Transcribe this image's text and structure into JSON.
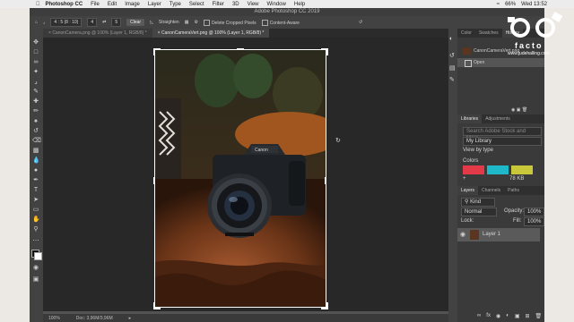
{
  "menubar": {
    "app_name": "Photoshop CC",
    "items": [
      "File",
      "Edit",
      "Image",
      "Layer",
      "Type",
      "Select",
      "Filter",
      "3D",
      "View",
      "Window",
      "Help"
    ],
    "battery": "66%",
    "clock": "Wed 13:52"
  },
  "window": {
    "title": "Adobe Photoshop CC 2019"
  },
  "options": {
    "ratio": "4 : 5 (8 : 10)",
    "width": "4",
    "height": "5",
    "clear_label": "Clear",
    "straighten_label": "Straighten",
    "delete_cropped_label": "Delete Cropped Pixels",
    "content_aware_label": "Content-Aware"
  },
  "tabs": [
    {
      "label": "CanonCamera.png @ 100% (Layer 1, RGB/8) *"
    },
    {
      "label": "CanonCameraVert.png @ 100% (Layer 1, RGB/8) *"
    }
  ],
  "status": {
    "zoom": "100%",
    "doc": "Doc: 3,96M/3,96M"
  },
  "history": {
    "tabs": [
      "Color",
      "Swatches",
      "History"
    ],
    "snapshot": "CanonCameraVert.png",
    "item": "Open"
  },
  "libraries": {
    "tabs": [
      "Libraries",
      "Adjustments"
    ],
    "search_placeholder": "Search Adobe Stock and More",
    "library": "My Library",
    "view_by": "View by type",
    "colors_label": "Colors",
    "swatch_colors": [
      "#e23a46",
      "#1eb8c8",
      "#c8c83a"
    ],
    "size": "78 KB"
  },
  "layers": {
    "tabs": [
      "Layers",
      "Channels",
      "Paths"
    ],
    "kind_label": "Kind",
    "blend_mode": "Normal",
    "opacity_label": "Opacity:",
    "opacity_value": "100%",
    "lock_label": "Lock:",
    "fill_label": "Fill:",
    "fill_value": "100%",
    "layer_name": "Layer 1"
  },
  "brand": {
    "text": "facto",
    "url": "www.judehalling.com"
  }
}
